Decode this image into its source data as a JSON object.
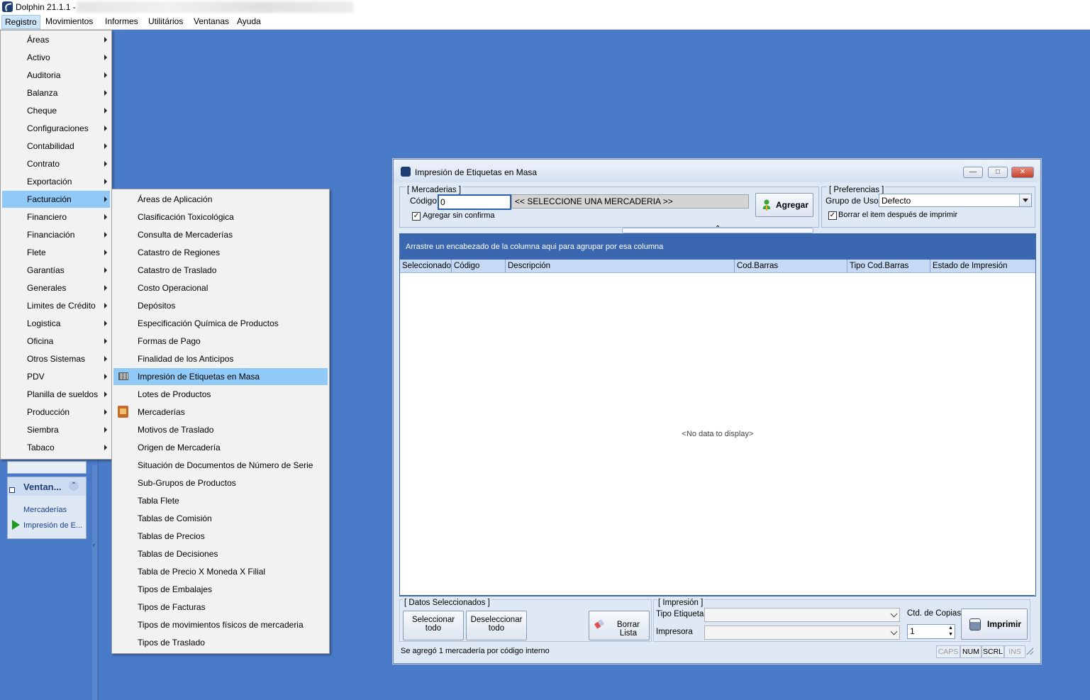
{
  "app": {
    "title": "Dolphin 21.1.1 -"
  },
  "menubar": {
    "items": [
      "Registro",
      "Movimientos",
      "Informes",
      "Utilitários",
      "Ventanas",
      "Ayuda"
    ]
  },
  "registro_menu": {
    "items": [
      "Áreas",
      "Activo",
      "Auditoria",
      "Balanza",
      "Cheque",
      "Configuraciones",
      "Contabilidad",
      "Contrato",
      "Exportación",
      "Facturación",
      "Financiero",
      "Financiación",
      "Flete",
      "Garantías",
      "Generales",
      "Limites de Crédito",
      "Logistica",
      "Oficina",
      "Otros Sistemas",
      "PDV",
      "Planilla de sueldos",
      "Producción",
      "Siembra",
      "Tabaco"
    ]
  },
  "facturacion_menu": {
    "items": [
      "Áreas de Aplicación",
      "Clasificación Toxicológica",
      "Consulta de Mercaderías",
      "Catastro de Regiones",
      "Catastro de Traslado",
      "Costo Operacional",
      "Depósitos",
      "Especificación Química de Productos",
      "Formas de Pago",
      "Finalidad de los Anticipos",
      "Impresión de Etiquetas en Masa",
      "Lotes de Productos",
      "Mercaderías",
      "Motivos de Traslado",
      "Origen de Mercadería",
      "Situación de Documentos de Número de Serie",
      "Sub-Grupos de Productos",
      "Tabla Flete",
      "Tablas de Comisión",
      "Tablas de Precios",
      "Tablas de Decisiones",
      "Tabla de Precio X Moneda X Filial",
      "Tipos de Embalajes",
      "Tipos de Facturas",
      "Tipos de movimientos físicos de mercaderia",
      "Tipos de Traslado"
    ]
  },
  "left_panel": {
    "title": "Ventan...",
    "links": [
      "Mercaderías",
      "Impresión de E..."
    ]
  },
  "window": {
    "title": "Impresión de Etiquetas en Masa",
    "mercaderias": {
      "group_title": "[ Mercaderias ]",
      "codigo_label": "Código",
      "codigo_value": "0",
      "select_text": "<< SELECCIONE UNA MERCADERIA >>",
      "agregar_sin_confirma": "Agregar sin confirma",
      "agregar_button": "Agregar"
    },
    "preferencias": {
      "group_title": "[ Preferencias ]",
      "grupo_label": "Grupo de Uso",
      "grupo_value": "Defecto",
      "borrar_item": "Borrar el item después de imprimir"
    },
    "grid": {
      "group_hint": "Arrastre un encabezado de la columna aqui para agrupar por esa columna",
      "columns": [
        "Seleccionado",
        "Código",
        "Descripción",
        "Cod.Barras",
        "Tipo Cod.Barras",
        "Estado de Impresión"
      ],
      "empty_text": "<No data to display>"
    },
    "datos": {
      "group_title": "[ Datos Seleccionados ]",
      "seleccionar_line1": "Seleccionar",
      "seleccionar_line2": "todo",
      "deseleccionar_line1": "Deseleccionar",
      "deseleccionar_line2": "todo",
      "borrar_lista": "Borrar Lista"
    },
    "impresion": {
      "group_title": "[ Impresión ]",
      "tipo_label": "Tipo Etiqueta",
      "impresora_label": "Impresora",
      "copias_label": "Ctd. de Copias",
      "copias_value": "1",
      "imprimir_button": "Imprimir"
    },
    "status": {
      "message": "Se agregó 1 mercadería por código interno",
      "indicators": [
        "CAPS",
        "NUM",
        "SCRL",
        "INS"
      ]
    }
  }
}
